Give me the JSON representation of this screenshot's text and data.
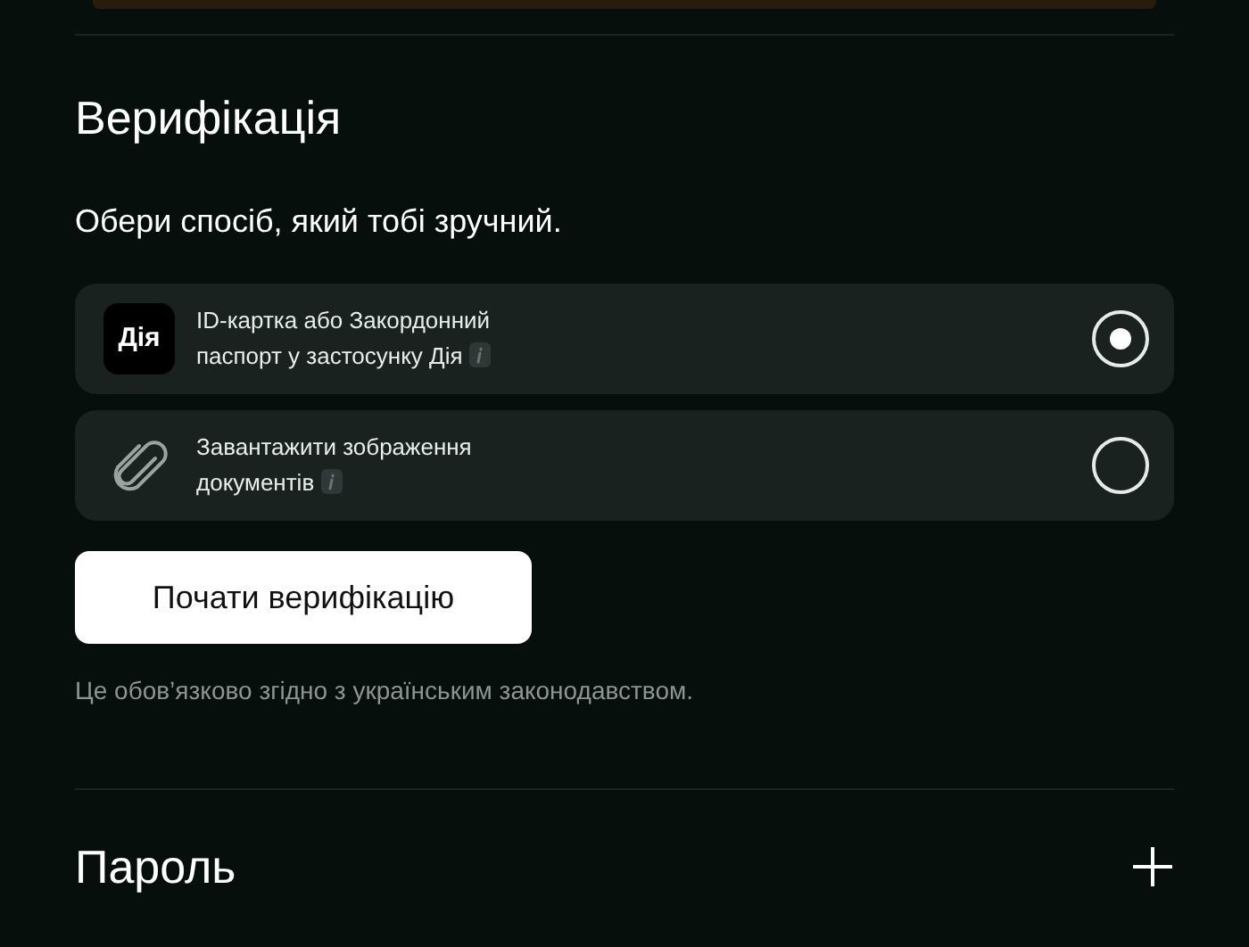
{
  "verification": {
    "title": "Верифікація",
    "subtitle": "Обери спосіб, який тобі зручний.",
    "options": [
      {
        "kind": "app",
        "logo": "Дія",
        "line1": "ID-картка або Закордонний",
        "line2": "паспорт у застосунку Дія",
        "selected": true
      },
      {
        "kind": "upload",
        "line1": "Завантажити зображення",
        "line2": "документів",
        "selected": false
      }
    ],
    "button": "Почати верифікацію",
    "note": "Це обов’язково згідно з українським законодавством."
  },
  "password": {
    "title": "Пароль",
    "expanded": false
  }
}
